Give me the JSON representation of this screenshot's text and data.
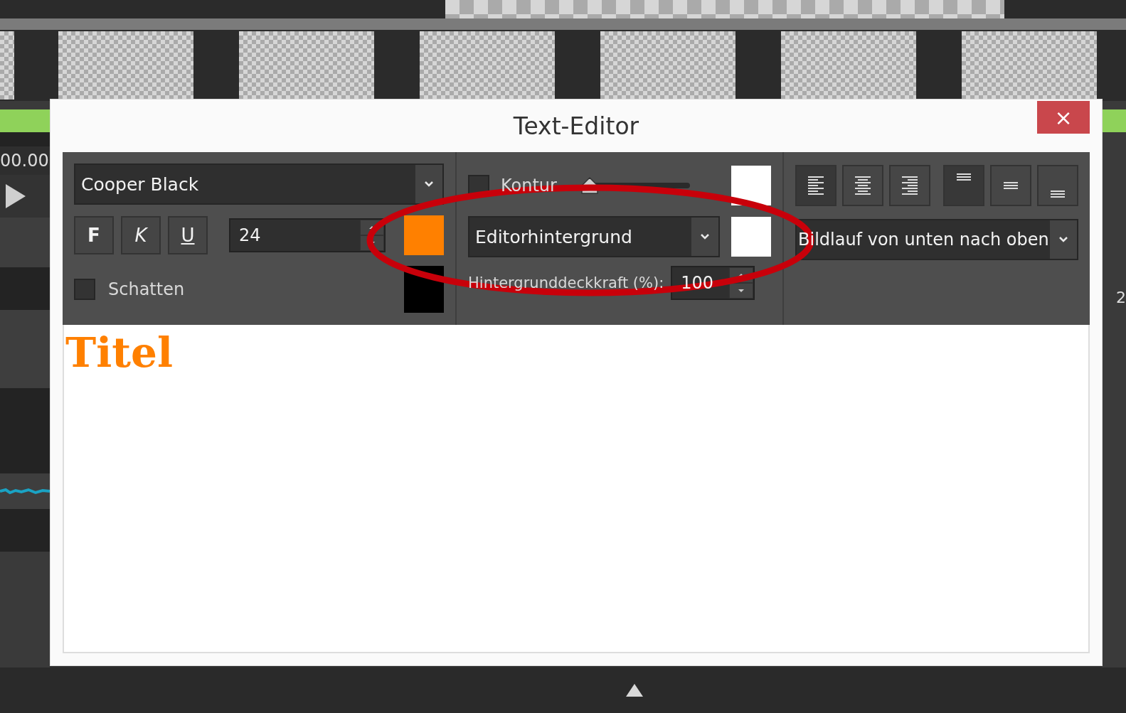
{
  "background": {
    "timecode": "00.00",
    "ruler_label": "2"
  },
  "dialog": {
    "title": "Text-Editor",
    "close": "×"
  },
  "font": {
    "value": "Cooper Black"
  },
  "style_buttons": [
    {
      "label": "F",
      "kind": "bold",
      "selected": false
    },
    {
      "label": "K",
      "kind": "italic",
      "selected": false
    },
    {
      "label": "U",
      "kind": "underline",
      "selected": false
    }
  ],
  "size": {
    "value": "24"
  },
  "text_color": {
    "color": "#ff8000"
  },
  "shadow": {
    "label": "Schatten",
    "checked": false,
    "color": "#000000"
  },
  "outline": {
    "label": "Kontur",
    "checked": false,
    "level": 0.05,
    "color": "#ffffff"
  },
  "background_mode": {
    "value": "Editorhintergrund",
    "color": "#ffffff"
  },
  "opacity": {
    "label": "Hintergrunddeckkraft (%):",
    "value": "100"
  },
  "alignment": [
    {
      "kind": "left",
      "selected": true
    },
    {
      "kind": "center",
      "selected": false
    },
    {
      "kind": "right",
      "selected": false
    },
    {
      "kind": "top",
      "selected": true
    },
    {
      "kind": "middle",
      "selected": false
    },
    {
      "kind": "bottom",
      "selected": false
    }
  ],
  "animation": {
    "value": "Bildlauf von unten nach oben"
  },
  "editor": {
    "text": "Titel"
  }
}
